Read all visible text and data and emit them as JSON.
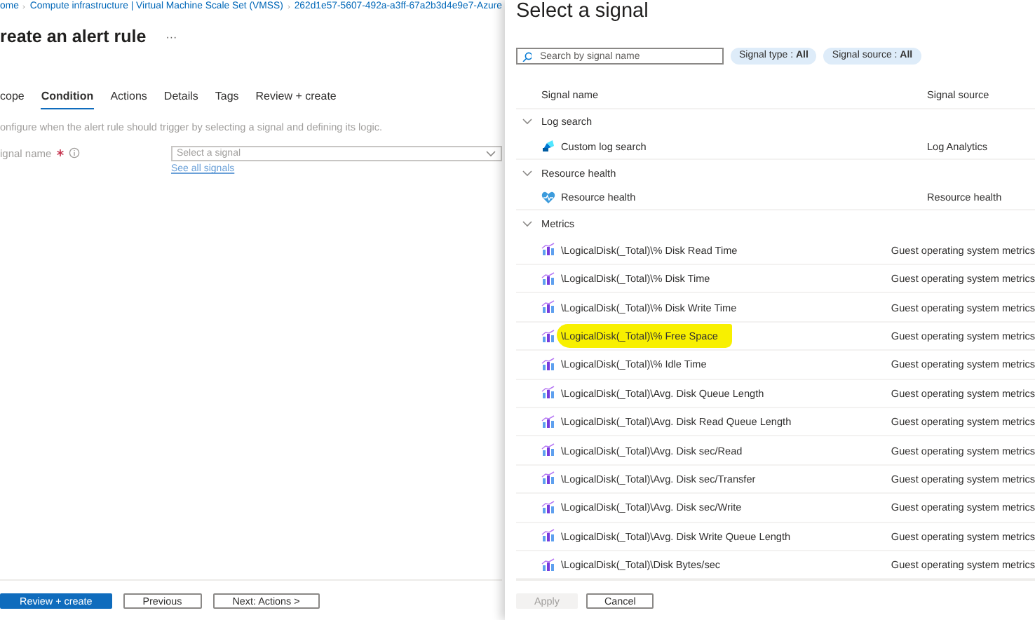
{
  "breadcrumb": [
    "ome",
    "Compute infrastructure | Virtual Machine Scale Set (VMSS)",
    "262d1e57-5607-492a-a3ff-67a2b3d4e9e7-Azure"
  ],
  "page_title": "reate an alert rule",
  "more_button": "···",
  "tabs": [
    {
      "label": "cope",
      "selected": false
    },
    {
      "label": "Condition",
      "selected": true
    },
    {
      "label": "Actions",
      "selected": false
    },
    {
      "label": "Details",
      "selected": false
    },
    {
      "label": "Tags",
      "selected": false
    },
    {
      "label": "Review + create",
      "selected": false
    }
  ],
  "description": "onfigure when the alert rule should trigger by selecting a signal and defining its logic.",
  "signal_field": {
    "label": "ignal name",
    "required": true,
    "placeholder": "Select a signal"
  },
  "see_all_link": "See all signals",
  "footer_buttons": [
    {
      "label": "Review + create",
      "kind": "primary"
    },
    {
      "label": "Previous",
      "kind": "secondary"
    },
    {
      "label": "Next: Actions >",
      "kind": "secondary"
    }
  ],
  "panel": {
    "title": "Select a signal",
    "search": {
      "placeholder": "Search by signal name"
    },
    "filters": [
      "Signal type : **All**",
      "Signal source : **All**"
    ],
    "columns": [
      "Signal name",
      "Signal source"
    ],
    "groups": [
      {
        "name": "Log search",
        "expanded": true,
        "rows": [
          {
            "name": "Custom log search",
            "source": "Log Analytics",
            "kind": "log",
            "highlighted": false
          }
        ]
      },
      {
        "name": "Resource health",
        "expanded": true,
        "rows": [
          {
            "name": "Resource health",
            "source": "Resource health",
            "kind": "health",
            "highlighted": false
          }
        ]
      },
      {
        "name": "Metrics",
        "expanded": true,
        "rows": [
          {
            "name": "\\LogicalDisk(_Total)\\% Disk Read Time",
            "source": "Guest operating system metrics",
            "kind": "metric",
            "highlighted": false
          },
          {
            "name": "\\LogicalDisk(_Total)\\% Disk Time",
            "source": "Guest operating system metrics",
            "kind": "metric",
            "highlighted": false
          },
          {
            "name": "\\LogicalDisk(_Total)\\% Disk Write Time",
            "source": "Guest operating system metrics",
            "kind": "metric",
            "highlighted": false
          },
          {
            "name": "\\LogicalDisk(_Total)\\% Free Space",
            "source": "Guest operating system metrics",
            "kind": "metric",
            "highlighted": true
          },
          {
            "name": "\\LogicalDisk(_Total)\\% Idle Time",
            "source": "Guest operating system metrics",
            "kind": "metric",
            "highlighted": false
          },
          {
            "name": "\\LogicalDisk(_Total)\\Avg. Disk Queue Length",
            "source": "Guest operating system metrics",
            "kind": "metric",
            "highlighted": false
          },
          {
            "name": "\\LogicalDisk(_Total)\\Avg. Disk Read Queue Length",
            "source": "Guest operating system metrics",
            "kind": "metric",
            "highlighted": false
          },
          {
            "name": "\\LogicalDisk(_Total)\\Avg. Disk sec/Read",
            "source": "Guest operating system metrics",
            "kind": "metric",
            "highlighted": false
          },
          {
            "name": "\\LogicalDisk(_Total)\\Avg. Disk sec/Transfer",
            "source": "Guest operating system metrics",
            "kind": "metric",
            "highlighted": false
          },
          {
            "name": "\\LogicalDisk(_Total)\\Avg. Disk sec/Write",
            "source": "Guest operating system metrics",
            "kind": "metric",
            "highlighted": false
          },
          {
            "name": "\\LogicalDisk(_Total)\\Avg. Disk Write Queue Length",
            "source": "Guest operating system metrics",
            "kind": "metric",
            "highlighted": false
          },
          {
            "name": "\\LogicalDisk(_Total)\\Disk Bytes/sec",
            "source": "Guest operating system metrics",
            "kind": "metric",
            "highlighted": false
          }
        ]
      }
    ],
    "buttons": [
      {
        "label": "Apply",
        "disabled": true
      },
      {
        "label": "Cancel",
        "disabled": false
      }
    ]
  }
}
